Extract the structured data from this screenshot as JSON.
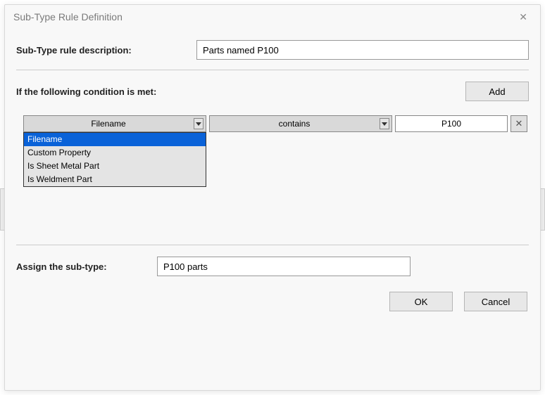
{
  "window": {
    "title": "Sub-Type Rule Definition",
    "close_label": "✕"
  },
  "description": {
    "label": "Sub-Type rule description:",
    "value": "Parts named P100"
  },
  "condition": {
    "label": "If the following condition is met:",
    "add_button": "Add",
    "field_selected": "Filename",
    "operator_selected": "contains",
    "value": "P100",
    "delete_icon": "✕",
    "options": [
      "Filename",
      "Custom Property",
      "Is Sheet Metal Part",
      "Is Weldment Part"
    ]
  },
  "assign": {
    "label": "Assign the sub-type:",
    "value": "P100 parts"
  },
  "footer": {
    "ok": "OK",
    "cancel": "Cancel"
  }
}
